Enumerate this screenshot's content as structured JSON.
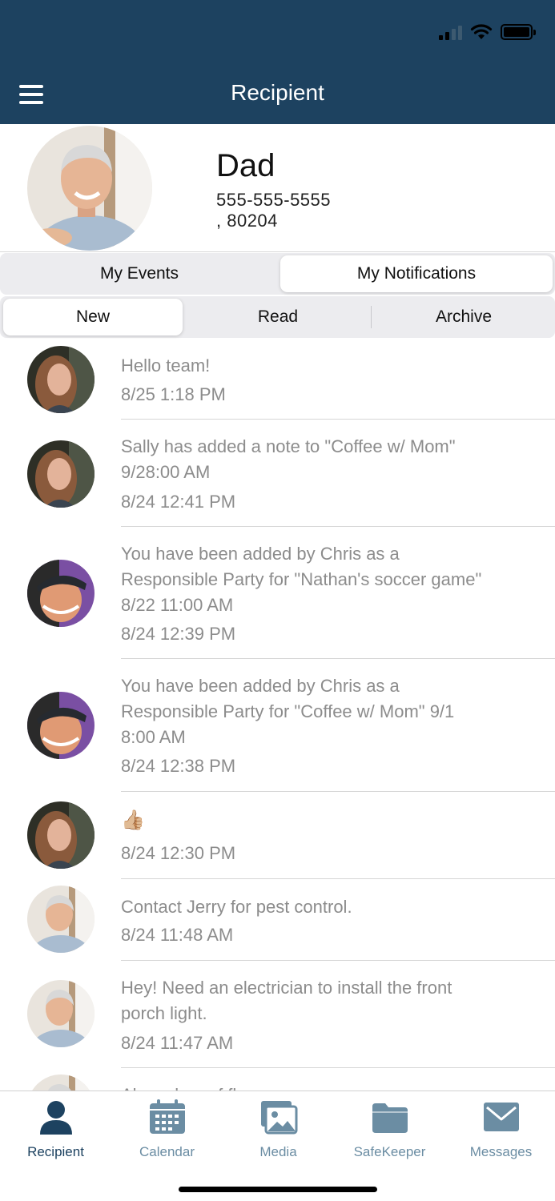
{
  "header": {
    "title": "Recipient"
  },
  "profile": {
    "name": "Dad",
    "phone": "555-555-5555",
    "zip": ", 80204"
  },
  "top_segment": {
    "options": [
      "My Events",
      "My Notifications"
    ],
    "selected": "My Notifications"
  },
  "sub_segment": {
    "options": [
      "New",
      "Read",
      "Archive"
    ],
    "selected": "New"
  },
  "notifications": [
    {
      "avatar": "woman-avatar",
      "lines": [
        "Hello team!"
      ],
      "time": "8/25 1:18 PM"
    },
    {
      "avatar": "woman-avatar",
      "lines": [
        "Sally has added a note to \"Coffee w/ Mom\"",
        "9/28:00 AM"
      ],
      "time": "8/24 12:41 PM"
    },
    {
      "avatar": "man-cap-avatar",
      "lines": [
        "You have been added by Chris as a",
        "Responsible Party for \"Nathan's soccer game\"",
        "8/22 11:00 AM"
      ],
      "time": "8/24 12:39 PM"
    },
    {
      "avatar": "man-cap-avatar",
      "lines": [
        "You have been added by Chris as a",
        "Responsible Party for \"Coffee w/ Mom\" 9/1",
        "8:00 AM"
      ],
      "time": "8/24 12:38 PM"
    },
    {
      "avatar": "woman-avatar",
      "lines": [
        "👍🏼"
      ],
      "time": "8/24 12:30 PM"
    },
    {
      "avatar": "dad-avatar",
      "lines": [
        "Contact Jerry for pest control."
      ],
      "time": "8/24 11:48 AM"
    },
    {
      "avatar": "dad-avatar",
      "lines": [
        "Hey! Need an electrician to install the front",
        "porch light."
      ],
      "time": "8/24 11:47 AM"
    },
    {
      "avatar": "dad-avatar",
      "lines": [
        "Also a box of fl..."
      ],
      "time": ""
    }
  ],
  "tabbar": [
    {
      "label": "Recipient",
      "icon": "person-icon",
      "active": true
    },
    {
      "label": "Calendar",
      "icon": "calendar-icon",
      "active": false
    },
    {
      "label": "Media",
      "icon": "photos-icon",
      "active": false
    },
    {
      "label": "SafeKeeper",
      "icon": "folder-icon",
      "active": false
    },
    {
      "label": "Messages",
      "icon": "envelope-icon",
      "active": false
    }
  ],
  "colors": {
    "header_bg": "#1d4260",
    "tab_active": "#1d4260",
    "tab_inactive": "#6b8da3",
    "muted_text": "#8c8c8c"
  }
}
